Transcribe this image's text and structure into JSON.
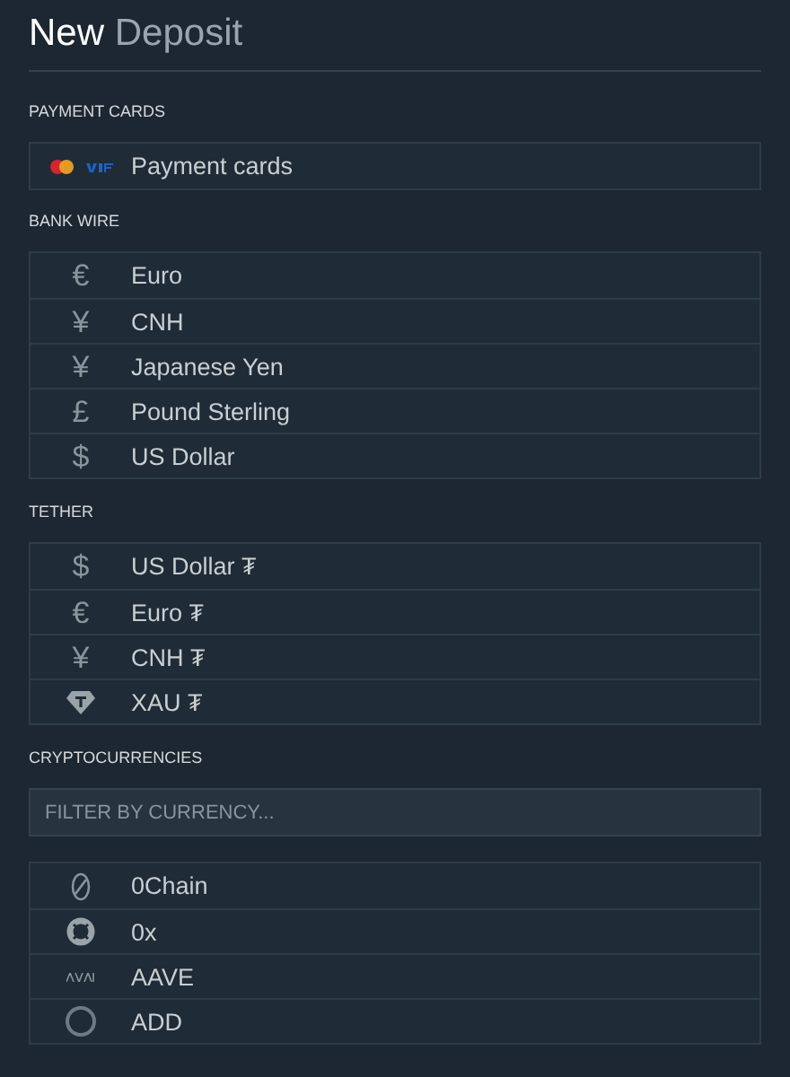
{
  "title": {
    "strong": "New",
    "light": "Deposit"
  },
  "sections": [
    {
      "heading": "PAYMENT CARDS",
      "items": [
        {
          "kind": "cards",
          "label": "Payment cards"
        }
      ]
    },
    {
      "heading": "BANK WIRE",
      "items": [
        {
          "kind": "symbol",
          "symbol": "€",
          "label": "Euro"
        },
        {
          "kind": "symbol",
          "symbol": "¥",
          "label": "CNH"
        },
        {
          "kind": "symbol",
          "symbol": "¥",
          "label": "Japanese Yen"
        },
        {
          "kind": "symbol",
          "symbol": "£",
          "label": "Pound Sterling"
        },
        {
          "kind": "symbol",
          "symbol": "$",
          "label": "US Dollar"
        }
      ]
    },
    {
      "heading": "TETHER",
      "items": [
        {
          "kind": "symbol",
          "symbol": "$",
          "label": "US Dollar ₮"
        },
        {
          "kind": "symbol",
          "symbol": "€",
          "label": "Euro ₮"
        },
        {
          "kind": "symbol",
          "symbol": "¥",
          "label": "CNH ₮"
        },
        {
          "kind": "icon",
          "label": "XAU ₮"
        }
      ]
    },
    {
      "heading": "CRYPTOCURRENCIES",
      "filter": {
        "placeholder": "FILTER BY CURRENCY..."
      },
      "items": [
        {
          "kind": "icon",
          "label": "0Chain"
        },
        {
          "kind": "icon",
          "label": "0x"
        },
        {
          "kind": "icon",
          "label": "AAVE"
        },
        {
          "kind": "icon",
          "label": "ADD"
        }
      ]
    }
  ]
}
